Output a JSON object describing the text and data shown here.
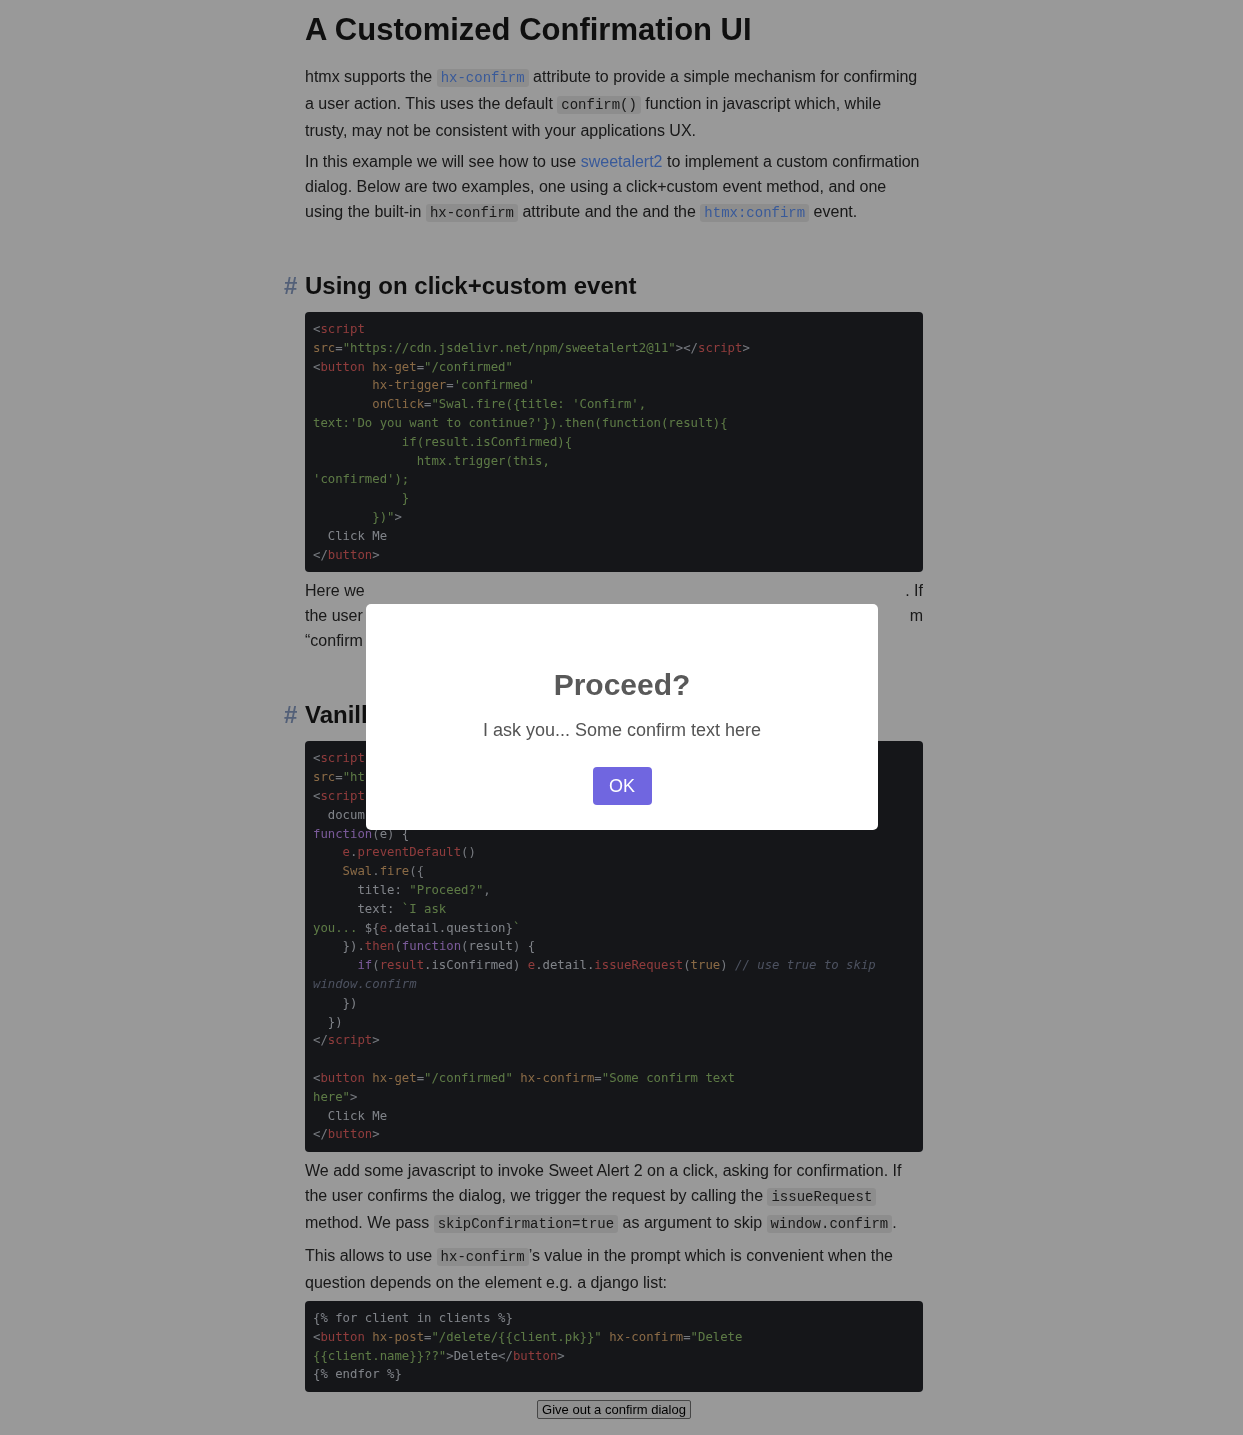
{
  "title": "A Customized Confirmation UI",
  "intro": [
    [
      {
        "kind": "text",
        "text": "htmx supports the "
      },
      {
        "kind": "code-link",
        "text": "hx-confirm"
      },
      {
        "kind": "text",
        "text": " attribute to provide a simple mechanism for confirming a user action. This uses the default "
      },
      {
        "kind": "code",
        "text": "confirm()"
      },
      {
        "kind": "text",
        "text": " function in javascript which, while trusty, may not be consistent with your applications UX."
      }
    ],
    [
      {
        "kind": "text",
        "text": "In this example we will see how to use "
      },
      {
        "kind": "link",
        "text": "sweetalert2"
      },
      {
        "kind": "text",
        "text": " to implement a custom confirmation dialog. Below are two examples, one using a click+custom event method, and one using the built-in "
      },
      {
        "kind": "code",
        "text": "hx-confirm"
      },
      {
        "kind": "text",
        "text": " attribute and the and the "
      },
      {
        "kind": "code-link",
        "text": "htmx:confirm"
      },
      {
        "kind": "text",
        "text": " event."
      }
    ]
  ],
  "section_1": {
    "anchor": "#",
    "heading": "Using on click+custom event",
    "code": [
      [
        [
          {
            "kind": "punct",
            "text": "<"
          },
          {
            "kind": "tag",
            "text": "script"
          }
        ],
        [
          {
            "kind": "attr",
            "text": "src"
          },
          {
            "kind": "punct",
            "text": "="
          },
          {
            "kind": "string",
            "text": "\"https://cdn.jsdelivr.net/npm/sweetalert2@11\""
          },
          {
            "kind": "punct",
            "text": "></"
          },
          {
            "kind": "tag",
            "text": "script"
          },
          {
            "kind": "punct",
            "text": ">"
          }
        ],
        [
          {
            "kind": "punct",
            "text": "<"
          },
          {
            "kind": "tag",
            "text": "button"
          },
          {
            "kind": "attr",
            "text": " hx-get"
          },
          {
            "kind": "punct",
            "text": "="
          },
          {
            "kind": "string",
            "text": "\"/confirmed\""
          }
        ],
        [
          {
            "kind": "attr",
            "text": "        hx-trigger"
          },
          {
            "kind": "punct",
            "text": "="
          },
          {
            "kind": "string",
            "text": "'confirmed'"
          }
        ],
        [
          {
            "kind": "attr",
            "text": "        onClick"
          },
          {
            "kind": "punct",
            "text": "="
          },
          {
            "kind": "string",
            "text": "\"Swal.fire({title: 'Confirm',"
          }
        ],
        [
          {
            "kind": "string",
            "text": "text:'Do you want to continue?'}).then(function(result){"
          }
        ],
        [
          {
            "kind": "string",
            "text": "            if(result.isConfirmed){"
          }
        ],
        [
          {
            "kind": "string",
            "text": "              htmx.trigger(this,"
          }
        ],
        [
          {
            "kind": "string",
            "text": "'confirmed');"
          }
        ],
        [
          {
            "kind": "string",
            "text": "            }"
          }
        ],
        [
          {
            "kind": "string",
            "text": "        })\""
          },
          {
            "kind": "punct",
            "text": ">"
          }
        ],
        [
          {
            "kind": "text",
            "text": "  Click Me"
          }
        ],
        [
          {
            "kind": "punct",
            "text": "</"
          },
          {
            "kind": "tag",
            "text": "button"
          },
          {
            "kind": "punct",
            "text": ">"
          }
        ]
      ]
    ],
    "after_lines": [
      {
        "left": "Here we",
        "right": ". If"
      },
      {
        "left": "the user",
        "right": "m"
      },
      {
        "left": "“confirm"
      }
    ]
  },
  "section_2": {
    "anchor": "#",
    "heading": "Vanill",
    "code": [
      [
        [
          {
            "kind": "punct",
            "text": "<"
          },
          {
            "kind": "tag",
            "text": "script"
          }
        ],
        [
          {
            "kind": "attr",
            "text": "src"
          },
          {
            "kind": "punct",
            "text": "="
          },
          {
            "kind": "string",
            "text": "\"ht"
          }
        ],
        [
          {
            "kind": "punct",
            "text": "<"
          },
          {
            "kind": "tag",
            "text": "script"
          }
        ],
        [
          {
            "kind": "text",
            "text": "  docum"
          }
        ],
        [
          {
            "kind": "keyword",
            "text": "function"
          },
          {
            "kind": "punct",
            "text": "("
          },
          {
            "kind": "text",
            "text": "e"
          },
          {
            "kind": "punct",
            "text": ")"
          },
          {
            "kind": "text",
            "text": " {"
          }
        ],
        [
          {
            "kind": "func",
            "text": "    e"
          },
          {
            "kind": "punct",
            "text": "."
          },
          {
            "kind": "func",
            "text": "preventDefault"
          },
          {
            "kind": "punct",
            "text": "()"
          }
        ],
        [
          {
            "kind": "attr",
            "text": "    Swal"
          },
          {
            "kind": "punct",
            "text": "."
          },
          {
            "kind": "attr",
            "text": "fire"
          },
          {
            "kind": "punct",
            "text": "({"
          }
        ],
        [
          {
            "kind": "text",
            "text": "      title: "
          },
          {
            "kind": "string",
            "text": "\"Proceed?\""
          },
          {
            "kind": "punct",
            "text": ","
          }
        ],
        [
          {
            "kind": "text",
            "text": "      text: "
          },
          {
            "kind": "string",
            "text": "`I ask"
          }
        ],
        [
          {
            "kind": "string",
            "text": "you... "
          },
          {
            "kind": "text",
            "text": "${"
          },
          {
            "kind": "func",
            "text": "e"
          },
          {
            "kind": "text",
            "text": ".detail.question}"
          },
          {
            "kind": "string",
            "text": "`"
          }
        ],
        [
          {
            "kind": "text",
            "text": "    })"
          },
          {
            "kind": "punct",
            "text": "."
          },
          {
            "kind": "func",
            "text": "then"
          },
          {
            "kind": "punct",
            "text": "("
          },
          {
            "kind": "keyword",
            "text": "function"
          },
          {
            "kind": "punct",
            "text": "("
          },
          {
            "kind": "text",
            "text": "result"
          },
          {
            "kind": "punct",
            "text": ")"
          },
          {
            "kind": "text",
            "text": " {"
          }
        ],
        [
          {
            "kind": "keyword",
            "text": "      if"
          },
          {
            "kind": "punct",
            "text": "("
          },
          {
            "kind": "func",
            "text": "result"
          },
          {
            "kind": "text",
            "text": ".isConfirmed) "
          },
          {
            "kind": "func",
            "text": "e"
          },
          {
            "kind": "text",
            "text": ".detail."
          },
          {
            "kind": "func",
            "text": "issueRequest"
          },
          {
            "kind": "punct",
            "text": "("
          },
          {
            "kind": "attr",
            "text": "true"
          },
          {
            "kind": "punct",
            "text": ")"
          },
          {
            "kind": "comment",
            "text": " // use true to skip"
          }
        ],
        [
          {
            "kind": "comment",
            "text": "window.confirm"
          }
        ],
        [
          {
            "kind": "text",
            "text": "    })"
          }
        ],
        [
          {
            "kind": "text",
            "text": "  })"
          }
        ],
        [
          {
            "kind": "punct",
            "text": "</"
          },
          {
            "kind": "tag",
            "text": "script"
          },
          {
            "kind": "punct",
            "text": ">"
          }
        ]
      ],
      [
        [
          {
            "kind": "punct",
            "text": "<"
          },
          {
            "kind": "tag",
            "text": "button"
          },
          {
            "kind": "attr",
            "text": " hx-get"
          },
          {
            "kind": "punct",
            "text": "="
          },
          {
            "kind": "string",
            "text": "\"/confirmed\""
          },
          {
            "kind": "attr",
            "text": " hx-confirm"
          },
          {
            "kind": "punct",
            "text": "="
          },
          {
            "kind": "string",
            "text": "\"Some confirm text"
          }
        ],
        [
          {
            "kind": "string",
            "text": "here\""
          },
          {
            "kind": "punct",
            "text": ">"
          }
        ],
        [
          {
            "kind": "text",
            "text": "  Click Me"
          }
        ],
        [
          {
            "kind": "punct",
            "text": "</"
          },
          {
            "kind": "tag",
            "text": "button"
          },
          {
            "kind": "punct",
            "text": ">"
          }
        ]
      ]
    ],
    "paragraphs": [
      [
        {
          "kind": "text",
          "text": "We add some javascript to invoke Sweet Alert 2 on a click, asking for confirmation. If the user confirms the dialog, we trigger the request by calling the "
        },
        {
          "kind": "code",
          "text": "issueRequest"
        },
        {
          "kind": "text",
          "text": " method. We pass "
        },
        {
          "kind": "code",
          "text": "skipConfirmation=true"
        },
        {
          "kind": "text",
          "text": " as argument to skip "
        },
        {
          "kind": "code",
          "text": "window.confirm"
        },
        {
          "kind": "text",
          "text": "."
        }
      ],
      [
        {
          "kind": "text",
          "text": "This allows to use "
        },
        {
          "kind": "code",
          "text": "hx-confirm"
        },
        {
          "kind": "text",
          "text": "’s value in the prompt which is convenient when the question depends on the element e.g. a django list:"
        }
      ]
    ],
    "code_2": [
      [
        [
          {
            "kind": "text",
            "text": "{% for client in clients %}"
          }
        ],
        [
          {
            "kind": "punct",
            "text": "<"
          },
          {
            "kind": "tag",
            "text": "button"
          },
          {
            "kind": "attr",
            "text": " hx-post"
          },
          {
            "kind": "punct",
            "text": "="
          },
          {
            "kind": "string",
            "text": "\"/delete/{{client.pk}}\""
          },
          {
            "kind": "attr",
            "text": " hx-confirm"
          },
          {
            "kind": "punct",
            "text": "="
          },
          {
            "kind": "string",
            "text": "\"Delete"
          }
        ],
        [
          {
            "kind": "string",
            "text": "{{client.name}}??\""
          },
          {
            "kind": "punct",
            "text": ">"
          },
          {
            "kind": "text",
            "text": "Delete"
          },
          {
            "kind": "punct",
            "text": "</"
          },
          {
            "kind": "tag",
            "text": "button"
          },
          {
            "kind": "punct",
            "text": ">"
          }
        ],
        [
          {
            "kind": "text",
            "text": "{% endfor %}"
          }
        ]
      ]
    ]
  },
  "demo_button": "Give out a confirm dialog",
  "dialog": {
    "title": "Proceed?",
    "text": "I ask you... Some confirm text here",
    "button": "OK"
  }
}
